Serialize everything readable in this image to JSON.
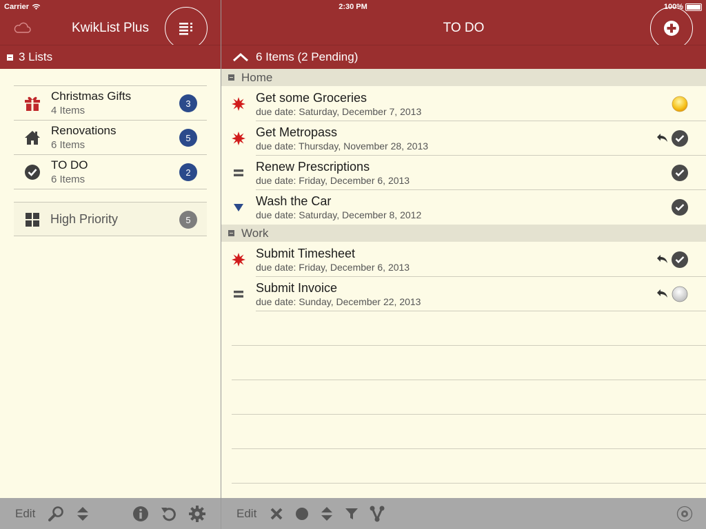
{
  "status_bar": {
    "carrier": "Carrier",
    "time": "2:30 PM",
    "battery": "100%"
  },
  "sidebar": {
    "app_title": "KwikList Plus",
    "lists_header": "3 Lists",
    "lists": [
      {
        "name": "Christmas Gifts",
        "count_text": "4 Items",
        "badge": "3",
        "icon": "gift-icon"
      },
      {
        "name": "Renovations",
        "count_text": "6 Items",
        "badge": "5",
        "icon": "house-icon"
      },
      {
        "name": "TO DO",
        "count_text": "6 Items",
        "badge": "2",
        "icon": "check-circle-icon"
      }
    ],
    "priority": {
      "name": "High Priority",
      "badge": "5",
      "icon": "grid-icon"
    },
    "toolbar": {
      "edit": "Edit"
    }
  },
  "main": {
    "title": "TO DO",
    "summary": "6 Items (2 Pending)",
    "sections": [
      {
        "name": "Home"
      },
      {
        "name": "Work"
      }
    ],
    "items": [
      {
        "title": "Get some Groceries",
        "due": "due date: Saturday, December 7, 2013",
        "priority": "high",
        "state": "pending-yellow",
        "undo": false
      },
      {
        "title": "Get Metropass",
        "due": "due date: Thursday, November 28, 2013",
        "priority": "high",
        "state": "done",
        "undo": true
      },
      {
        "title": "Renew Prescriptions",
        "due": "due date: Friday, December 6, 2013",
        "priority": "normal",
        "state": "done",
        "undo": false
      },
      {
        "title": "Wash the Car",
        "due": "due date: Saturday, December 8, 2012",
        "priority": "low",
        "state": "done",
        "undo": false
      },
      {
        "title": "Submit Timesheet",
        "due": "due date: Friday, December 6, 2013",
        "priority": "high",
        "state": "done",
        "undo": true
      },
      {
        "title": "Submit Invoice",
        "due": "due date: Sunday, December 22, 2013",
        "priority": "normal",
        "state": "pending-grey",
        "undo": true
      }
    ],
    "toolbar": {
      "edit": "Edit"
    }
  },
  "colors": {
    "header": "#9a2f2f",
    "badge": "#2b4a8b",
    "background": "#fdfbe6",
    "high_priority": "#d11b1b",
    "low_priority": "#2b4a8b"
  }
}
